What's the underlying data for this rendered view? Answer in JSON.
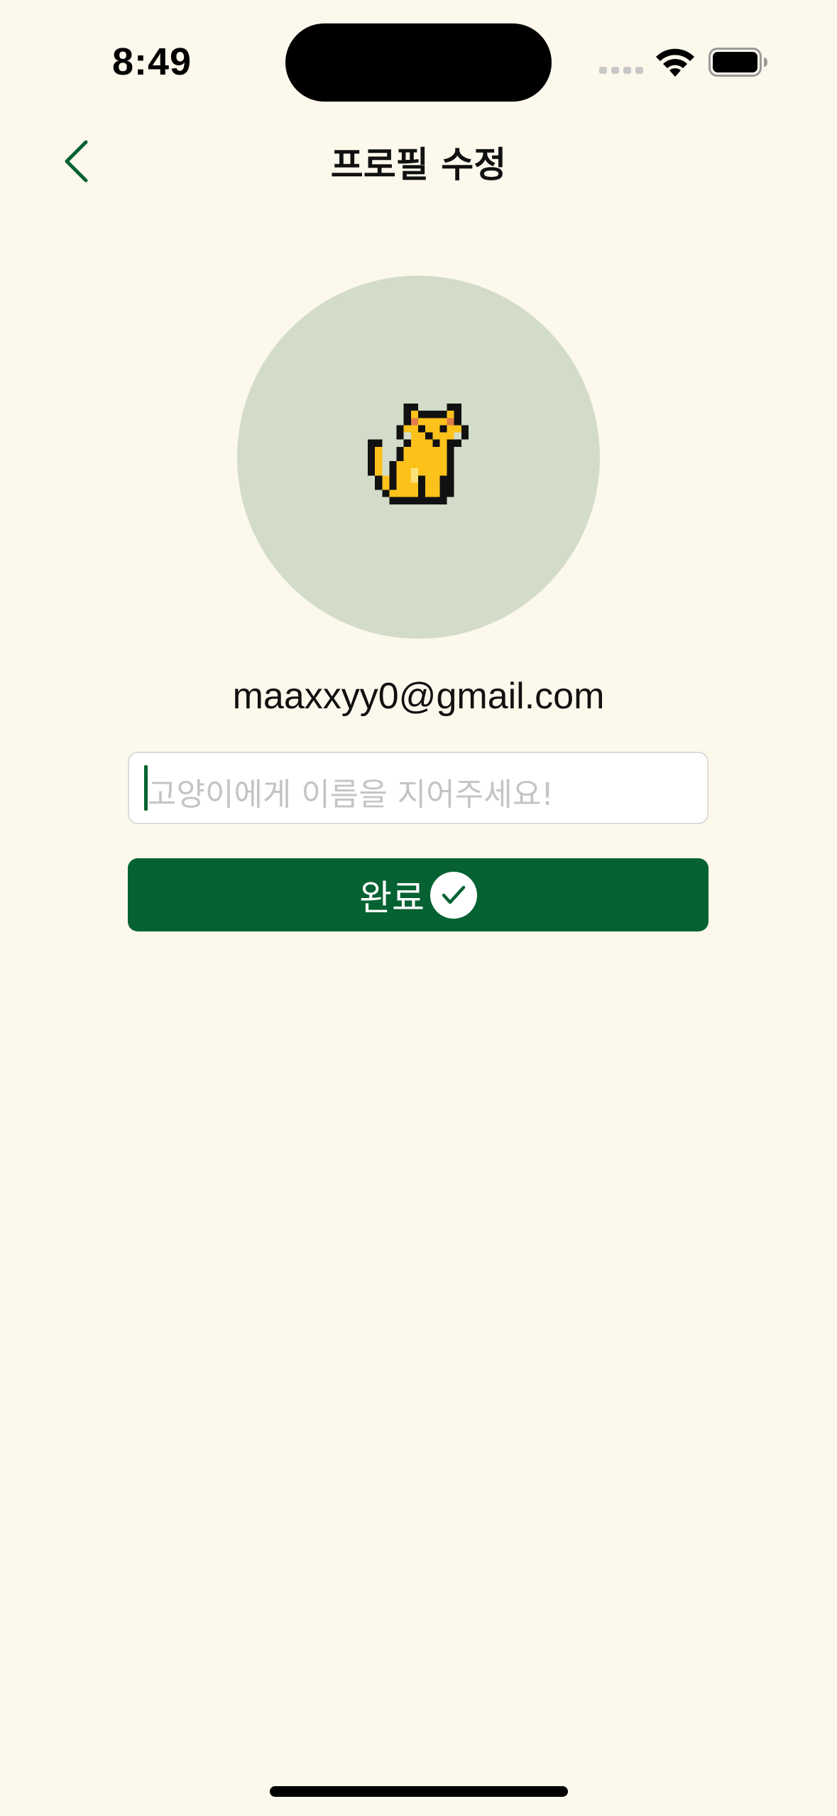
{
  "status_bar": {
    "time": "8:49"
  },
  "nav": {
    "title": "프로필 수정",
    "back_icon": "chevron-left-icon"
  },
  "profile": {
    "avatar_icon": "pixel-cat",
    "email": "maaxxyy0@gmail.com"
  },
  "name_input": {
    "value": "",
    "placeholder": "고양이에게 이름을 지어주세요!"
  },
  "done_button": {
    "label": "완료",
    "icon": "check-icon"
  },
  "colors": {
    "background": "#fcf8eb",
    "accent": "#066232",
    "avatar_bg": "#d2dcc9",
    "cat_fill": "#fcc21b"
  }
}
